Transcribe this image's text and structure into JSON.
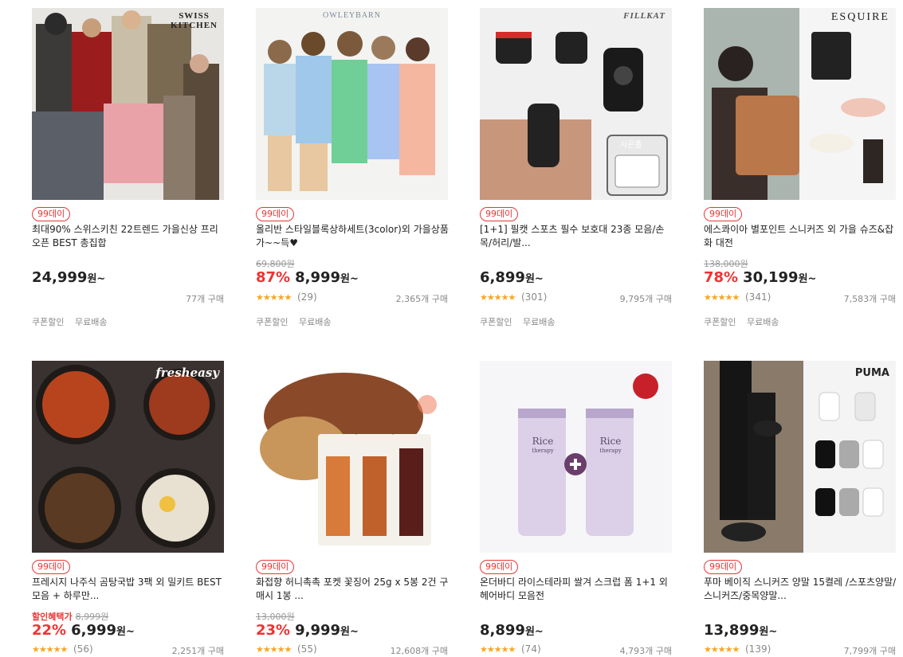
{
  "products": [
    {
      "brand": "SWISS\nKITCHEN",
      "badge": "99데이",
      "title": "최대90% 스위스키친 22트렌드 가을신상 프리오픈 BEST 총집합",
      "original_price": "",
      "discount": "",
      "price": "24,999",
      "unit": "원~",
      "stars": "",
      "reviews": "",
      "sold": "77개 구매",
      "tags": [
        "쿠폰할인",
        "무료배송"
      ]
    },
    {
      "brand": "OWLEYBARN",
      "badge": "99데이",
      "title": "올리반 스타일블록상하세트(3color)외 가을상품 가~~득♥",
      "original_price": "69,800원",
      "discount": "87%",
      "price": "8,999",
      "unit": "원~",
      "stars": "★★★★★",
      "reviews": "(29)",
      "sold": "2,365개 구매",
      "tags": [
        "쿠폰할인",
        "무료배송"
      ]
    },
    {
      "brand": "FILLKAT",
      "badge": "99데이",
      "title": "[1+1] 필캣 스포츠 필수 보호대 23종 모음/손목/허리/발...",
      "original_price": "",
      "discount": "",
      "price": "6,899",
      "unit": "원~",
      "stars": "★★★★★",
      "reviews": "(301)",
      "sold": "9,795개 구매",
      "tags": [
        "쿠폰할인",
        "무료배송"
      ],
      "gift_label": "사은품"
    },
    {
      "brand": "ESQUIRE",
      "badge": "99데이",
      "title": "에스콰이아 별포인트 스니커즈 외 가을 슈즈&잡화 대전",
      "original_price": "138,000원",
      "discount": "78%",
      "price": "30,199",
      "unit": "원~",
      "stars": "★★★★★",
      "reviews": "(341)",
      "sold": "7,583개 구매",
      "tags": [
        "쿠폰할인",
        "무료배송"
      ]
    },
    {
      "brand": "fresheasy",
      "badge": "99데이",
      "title": "프레시지 나주식 곰탕국밥 3팩 외 밀키트 BEST 모음 + 하루만...",
      "benefit_label": "할인혜택가",
      "original_price": "8,999원",
      "discount": "22%",
      "price": "6,999",
      "unit": "원~",
      "stars": "★★★★★",
      "reviews": "(56)",
      "sold": "2,251개 구매",
      "tags": []
    },
    {
      "brand": "",
      "badge": "99데이",
      "title": "화접향 허니촉촉 포켓 꽃징어 25g x 5봉 2건 구매시 1봉 ...",
      "original_price": "13,000원",
      "discount": "23%",
      "price": "9,999",
      "unit": "원~",
      "stars": "★★★★★",
      "reviews": "(55)",
      "sold": "12,608개 구매",
      "tags": []
    },
    {
      "brand": "",
      "badge": "99데이",
      "title": "온더바디 라이스테라피 쌀겨 스크럽 폼 1+1 외 헤어바디 모음전",
      "original_price": "",
      "discount": "",
      "price": "8,899",
      "unit": "원~",
      "stars": "★★★★★",
      "reviews": "(74)",
      "sold": "4,793개 구매",
      "tags": [],
      "product_text": "Rice",
      "product_sub": "therapy"
    },
    {
      "brand": "PUMA",
      "badge": "99데이",
      "title": "푸마 베이직 스니커즈 양말 15켤레 /스포츠양말/스니커즈/중목양말...",
      "original_price": "",
      "discount": "",
      "price": "13,899",
      "unit": "원~",
      "stars": "★★★★★",
      "reviews": "(139)",
      "sold": "7,799개 구매",
      "tags": []
    }
  ],
  "colors": {
    "accent": "#e33333",
    "star": "#f5a623",
    "muted": "#888888"
  }
}
